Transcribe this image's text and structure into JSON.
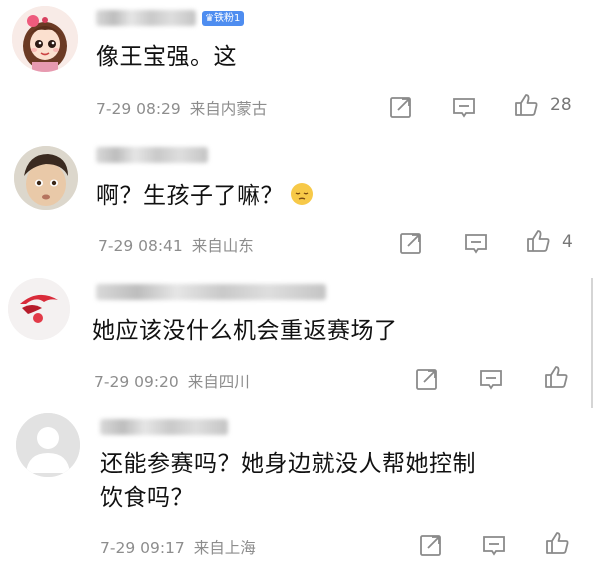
{
  "comments": [
    {
      "badge": "铁粉1",
      "text": "像王宝强。这",
      "date": "7-29 08:29",
      "location": "来自内蒙古",
      "likes": "28"
    },
    {
      "text": "啊？生孩子了嘛？",
      "emoji": "pensive-face",
      "date": "7-29 08:41",
      "location": "来自山东",
      "likes": "4"
    },
    {
      "text": "她应该没什么机会重返赛场了",
      "date": "7-29 09:20",
      "location": "来自四川",
      "likes": ""
    },
    {
      "text_line1": "还能参赛吗？她身边就没人帮她控制",
      "text_line2": "饮食吗？",
      "date": "7-29 09:17",
      "location": "来自上海",
      "likes": ""
    }
  ],
  "icons": {
    "share": "share-icon",
    "comment": "comment-icon",
    "like": "thumbs-up-icon"
  },
  "colors": {
    "badge": "#4e8df0",
    "meta_text": "#8d8d8d",
    "icon_stroke": "#8a8a8a"
  }
}
